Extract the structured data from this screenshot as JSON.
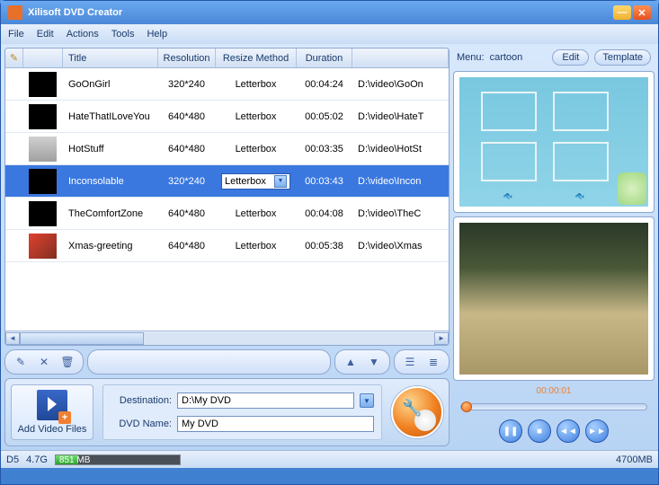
{
  "app": {
    "title": "Xilisoft DVD Creator"
  },
  "menu": [
    "File",
    "Edit",
    "Actions",
    "Tools",
    "Help"
  ],
  "columns": {
    "title": "Title",
    "resolution": "Resolution",
    "resize": "Resize Method",
    "duration": "Duration"
  },
  "rows": [
    {
      "title": "GoOnGirl",
      "res": "320*240",
      "resize": "Letterbox",
      "dur": "00:04:24",
      "path": "D:\\video\\GoOn"
    },
    {
      "title": "HateThatILoveYou",
      "res": "640*480",
      "resize": "Letterbox",
      "dur": "00:05:02",
      "path": "D:\\video\\HateT"
    },
    {
      "title": "HotStuff",
      "res": "640*480",
      "resize": "Letterbox",
      "dur": "00:03:35",
      "path": "D:\\video\\HotSt"
    },
    {
      "title": "Inconsolable",
      "res": "320*240",
      "resize": "Letterbox",
      "dur": "00:03:43",
      "path": "D:\\video\\Incon"
    },
    {
      "title": "TheComfortZone",
      "res": "640*480",
      "resize": "Letterbox",
      "dur": "00:04:08",
      "path": "D:\\video\\TheC"
    },
    {
      "title": "Xmas-greeting",
      "res": "640*480",
      "resize": "Letterbox",
      "dur": "00:05:38",
      "path": "D:\\video\\Xmas"
    }
  ],
  "selected_row": 3,
  "add_label": "Add Video Files",
  "dest": {
    "label": "Destination:",
    "value": "D:\\My DVD"
  },
  "dvdname": {
    "label": "DVD Name:",
    "value": "My DVD"
  },
  "menu_preview": {
    "label": "Menu:",
    "name": "cartoon",
    "edit": "Edit",
    "template": "Template"
  },
  "player": {
    "time": "00:00:01"
  },
  "status": {
    "disc": "D5",
    "capacity": "4.7G",
    "used": "851 MB",
    "total": "4700MB"
  }
}
